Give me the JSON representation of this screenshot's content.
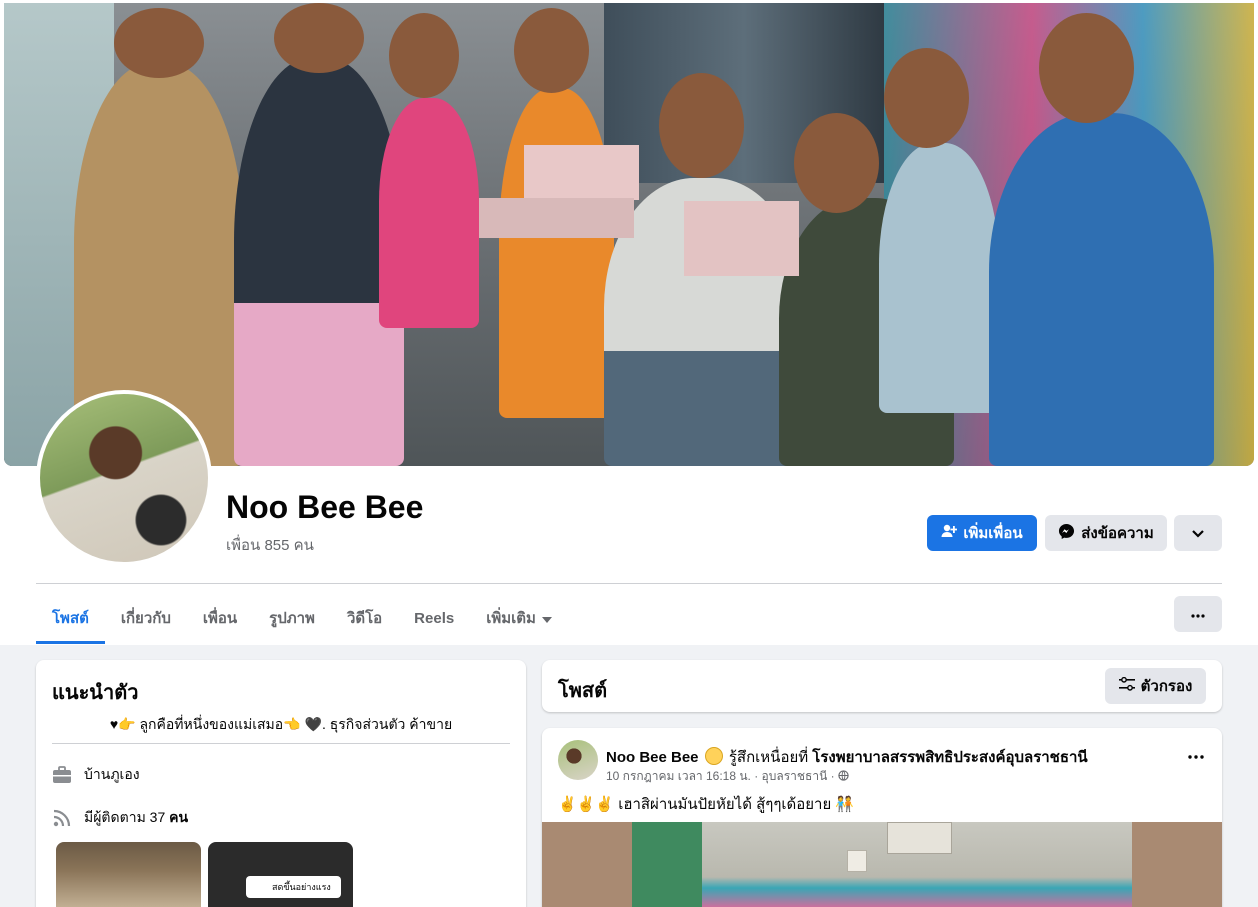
{
  "profile": {
    "name": "Noo Bee Bee",
    "friends_count": "เพื่อน 855 คน"
  },
  "actions": {
    "add_friend": "เพิ่มเพื่อน",
    "message": "ส่งข้อความ"
  },
  "tabs": [
    {
      "label": "โพสต์",
      "active": true
    },
    {
      "label": "เกี่ยวกับ",
      "active": false
    },
    {
      "label": "เพื่อน",
      "active": false
    },
    {
      "label": "รูปภาพ",
      "active": false
    },
    {
      "label": "วิดีโอ",
      "active": false
    },
    {
      "label": "Reels",
      "active": false
    },
    {
      "label": "เพิ่มเติม",
      "active": false
    }
  ],
  "intro": {
    "title": "แนะนำตัว",
    "bio": "♥👉 ลูกคือที่หนึ่งของแม่เสมอ👈 🖤. ธุรกิจส่วนตัว ค้าขาย",
    "work": "บ้านภูเอง",
    "followers_prefix": "มีผู้ติดตาม 37 ",
    "followers_suffix": "คน",
    "live_caption": "สดขึ้นอย่างแรง"
  },
  "posts": {
    "title": "โพสต์",
    "filter_label": "ตัวกรอง"
  },
  "post": {
    "author": "Noo Bee Bee",
    "feeling": "รู้สึกเหนื่อยที่",
    "place": "โรงพยาบาลสรรพสิทธิประสงค์อุบลราชธานี",
    "meta": "10 กรกฎาคม เวลา 16:18 น. · อุบลราชธานี ·",
    "text": "✌️✌️✌️ เฮาสิผ่านมันปัยหัยได้ สู้ๆๆเด้อยาย 🧑‍🤝‍🧑"
  },
  "colors": {
    "accent": "#1b74e4",
    "secondary_button": "#e4e6eb",
    "page_bg": "#f0f2f5",
    "muted_text": "#65676b"
  },
  "icons": [
    "add-friend-icon",
    "messenger-icon",
    "chevron-down-icon",
    "more-icon",
    "briefcase-icon",
    "rss-icon",
    "filter-icon",
    "globe-icon"
  ]
}
